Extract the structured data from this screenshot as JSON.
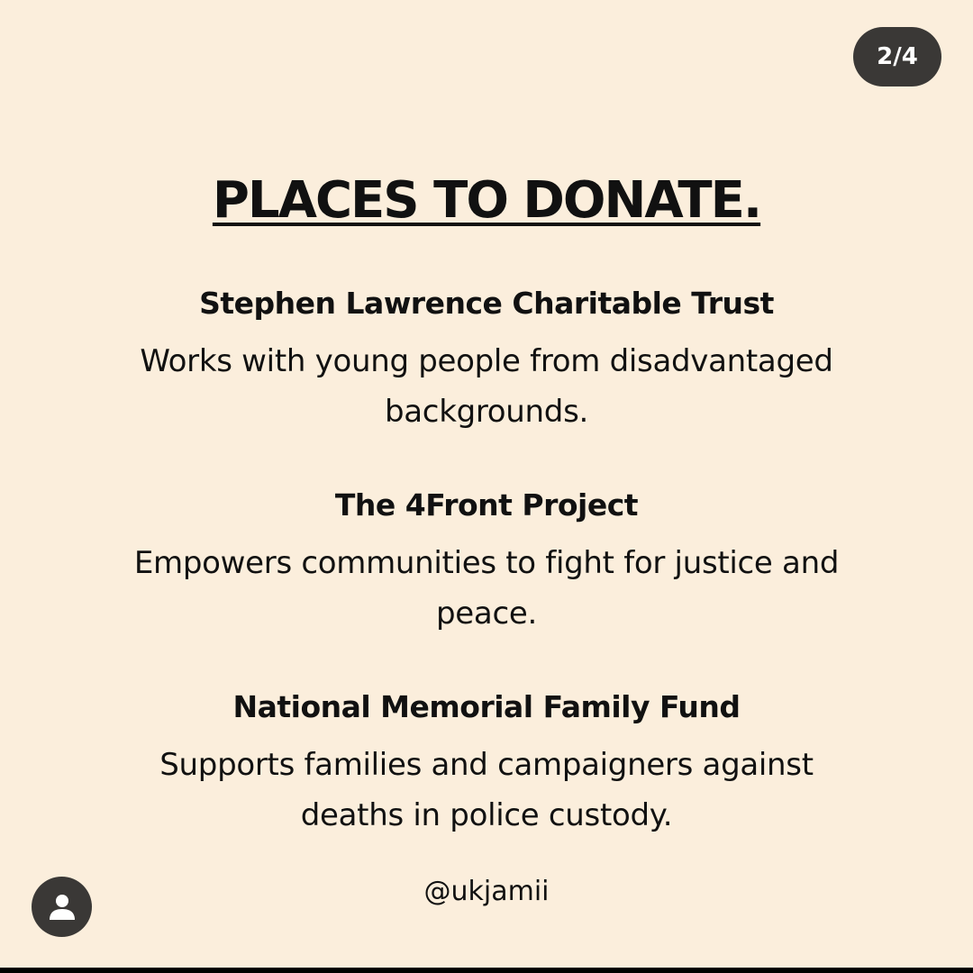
{
  "page_indicator": "2/4",
  "title": "PLACES TO DONATE.",
  "entries": [
    {
      "name": "Stephen Lawrence Charitable Trust",
      "description": "Works with young people from disadvantaged backgrounds."
    },
    {
      "name": "The 4Front Project",
      "description": "Empowers communities to fight for justice and peace."
    },
    {
      "name": "National Memorial Family Fund",
      "description": "Supports families and campaigners against deaths in police custody."
    }
  ],
  "handle": "@ukjamii",
  "icons": {
    "avatar": "user-icon"
  },
  "colors": {
    "background": "#FBEEDC",
    "badge": "#3A3836",
    "text": "#111111"
  }
}
